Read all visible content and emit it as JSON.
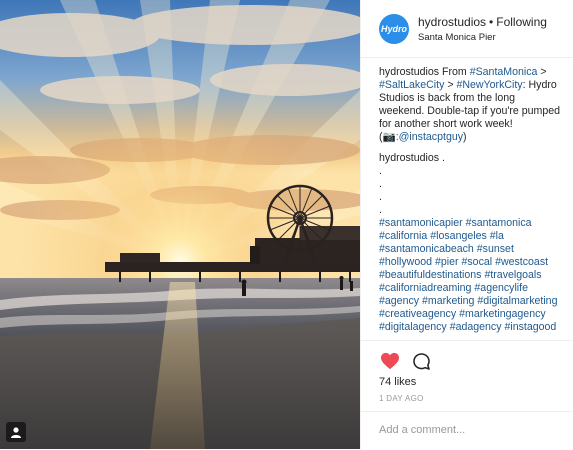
{
  "header": {
    "avatar_text": "Hydro",
    "username": "hydrostudios",
    "separator": "•",
    "follow_status": "Following",
    "location": "Santa Monica Pier"
  },
  "caption": {
    "username": "hydrostudios",
    "from_text": "From",
    "tags": [
      "#SantaMonica",
      "#SaltLakeCity",
      "#NewYorkCity"
    ],
    "arrow": ">",
    "colon": ":",
    "body": "Hydro Studios is back from the long weekend. Double-tap if you're pumped for another short work week! (",
    "camera_icon": "camera-icon",
    "credit": ":@instacptguy",
    "close_paren": ")"
  },
  "comment": {
    "username": "hydrostudios",
    "trail": ".",
    "dots": [
      ".",
      ".",
      ".",
      "."
    ],
    "hashtags": [
      "#santamonicapier",
      "#santamonica",
      "#california",
      "#losangeles",
      "#la",
      "#santamonicabeach",
      "#sunset",
      "#hollywood",
      "#pier",
      "#socal",
      "#westcoast",
      "#beautifuldestinations",
      "#travelgoals",
      "#californiadreaming",
      "#agencylife",
      "#agency",
      "#marketing",
      "#digitalmarketing",
      "#creativeagency",
      "#marketingagency",
      "#digitalagency",
      "#adagency",
      "#instagood"
    ]
  },
  "actions": {
    "like_icon": "heart-icon",
    "comment_icon": "speech-bubble-icon",
    "liked": true,
    "likes_text": "74 likes",
    "time_text": "1 DAY AGO"
  },
  "comment_input": {
    "placeholder": "Add a comment..."
  },
  "photo": {
    "tag_badge_icon": "user-tag-icon"
  },
  "colors": {
    "heart": "#ed4956",
    "hashtag": "#1f5a8f",
    "avatar": "#2b8ee8",
    "muted": "#999999"
  }
}
